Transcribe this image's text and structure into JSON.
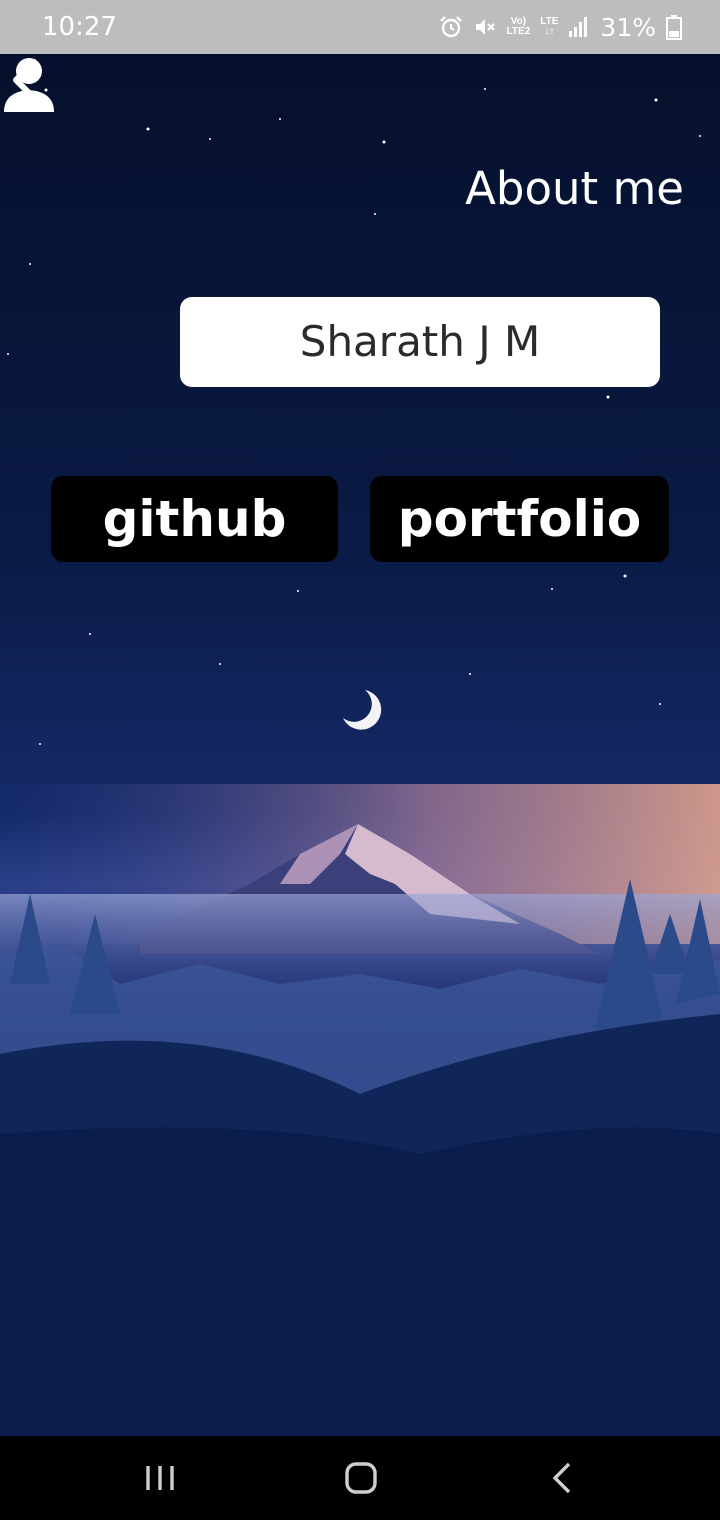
{
  "status_bar": {
    "time": "10:27",
    "network_label_top": "Vo)",
    "network_label_bottom": "LTE2",
    "lte_label": "LTE",
    "battery_percent": "31%",
    "icons": [
      "alarm-icon",
      "mute-icon",
      "signal-icon",
      "battery-icon"
    ]
  },
  "header": {
    "title": "About me",
    "back_icon": "chevron-left-icon"
  },
  "profile": {
    "user_icon": "person-icon",
    "name": "Sharath J M"
  },
  "links": {
    "github_label": "github",
    "portfolio_label": "portfolio"
  },
  "nav": {
    "recents_icon": "recents-icon",
    "home_icon": "home-icon",
    "back_icon": "back-icon"
  },
  "colors": {
    "status_bar": "#bdbdbd",
    "link_button_bg": "#000000",
    "name_field_bg": "#ffffff",
    "night_sky": "#0a1436"
  }
}
